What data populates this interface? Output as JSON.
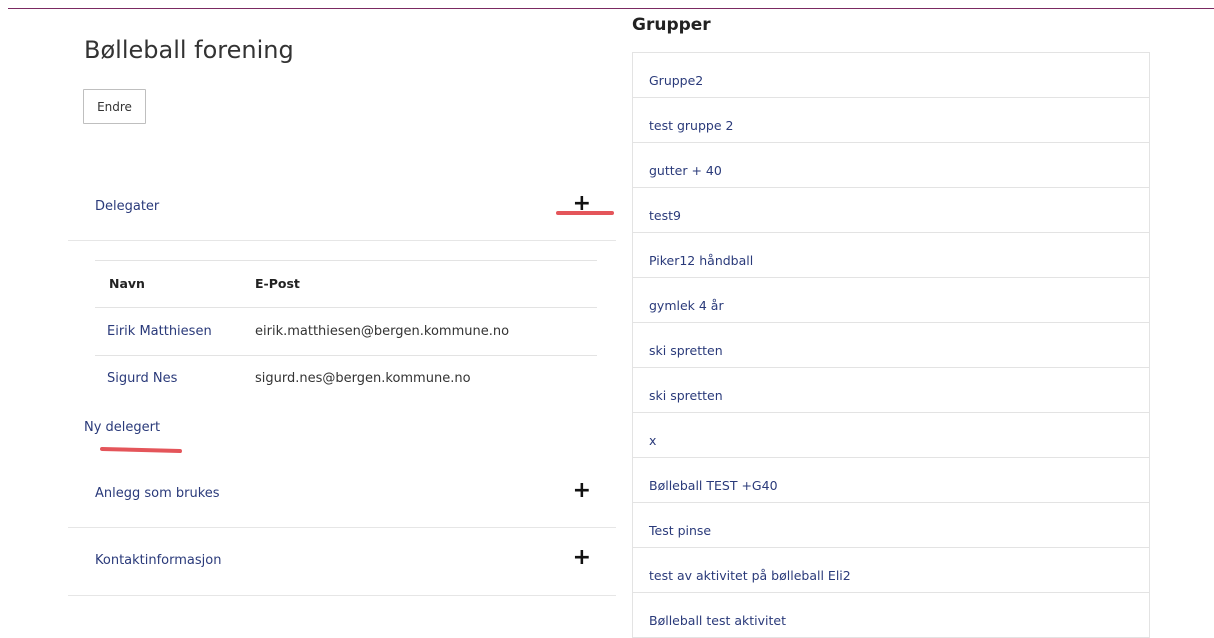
{
  "page": {
    "title": "Bølleball forening",
    "edit_button": "Endre"
  },
  "accordion": {
    "delegater": "Delegater",
    "anlegg": "Anlegg som brukes",
    "kontakt": "Kontaktinformasjon",
    "plus_symbol": "+"
  },
  "delegates": {
    "headers": {
      "name": "Navn",
      "email": "E-Post"
    },
    "rows": [
      {
        "name": "Eirik Matthiesen",
        "email": "eirik.matthiesen@bergen.kommune.no"
      },
      {
        "name": "Sigurd Nes",
        "email": "sigurd.nes@bergen.kommune.no"
      }
    ],
    "new_link": "Ny delegert"
  },
  "groups": {
    "title": "Grupper",
    "items": [
      "Gruppe2",
      "test gruppe 2",
      "gutter + 40",
      "test9",
      "Piker12 håndball",
      "gymlek 4 år",
      "ski spretten",
      "ski spretten",
      "x",
      "Bølleball TEST +G40",
      "Test pinse",
      "test av aktivitet på bølleball Eli2",
      "Bølleball test aktivitet"
    ]
  },
  "colors": {
    "link": "#2a3a7a",
    "annotation_red": "#e4555a",
    "top_border": "#7b2a62"
  }
}
